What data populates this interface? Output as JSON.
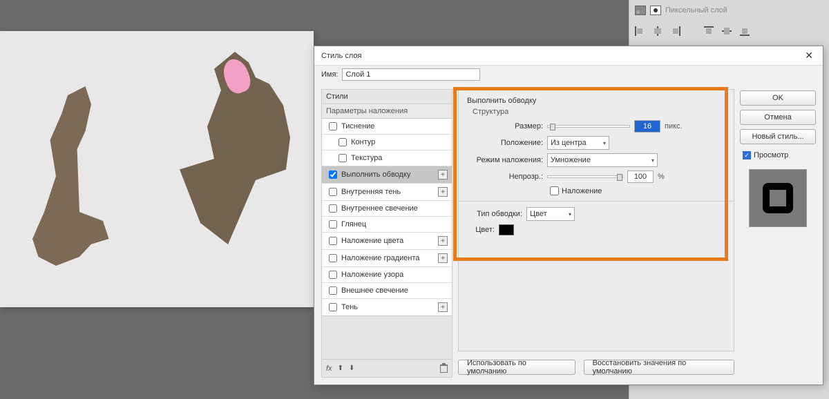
{
  "layerPanel": {
    "layerName": "Пиксельный слой"
  },
  "dialog": {
    "title": "Стиль слоя",
    "nameLabel": "Имя:",
    "nameValue": "Слой 1",
    "stylesHeader": "Стили",
    "paramsHeader": "Параметры наложения",
    "items": [
      {
        "label": "Тиснение",
        "checked": false,
        "indent": false,
        "plus": false
      },
      {
        "label": "Контур",
        "checked": false,
        "indent": true,
        "plus": false
      },
      {
        "label": "Текстура",
        "checked": false,
        "indent": true,
        "plus": false
      },
      {
        "label": "Выполнить обводку",
        "checked": true,
        "indent": false,
        "plus": true,
        "active": true
      },
      {
        "label": "Внутренняя тень",
        "checked": false,
        "indent": false,
        "plus": true
      },
      {
        "label": "Внутреннее свечение",
        "checked": false,
        "indent": false,
        "plus": false
      },
      {
        "label": "Глянец",
        "checked": false,
        "indent": false,
        "plus": false
      },
      {
        "label": "Наложение цвета",
        "checked": false,
        "indent": false,
        "plus": true
      },
      {
        "label": "Наложение градиента",
        "checked": false,
        "indent": false,
        "plus": true
      },
      {
        "label": "Наложение узора",
        "checked": false,
        "indent": false,
        "plus": false
      },
      {
        "label": "Внешнее свечение",
        "checked": false,
        "indent": false,
        "plus": false
      },
      {
        "label": "Тень",
        "checked": false,
        "indent": false,
        "plus": true
      }
    ],
    "fxLabel": "fx",
    "settings": {
      "groupTitle": "Выполнить обводку",
      "structTitle": "Структура",
      "sizeLabel": "Размер:",
      "sizeValue": "16",
      "sizeUnit": "пикс.",
      "positionLabel": "Положение:",
      "positionValue": "Из центра",
      "blendLabel": "Режим наложения:",
      "blendValue": "Умножение",
      "opacityLabel": "Непрозр.:",
      "opacityValue": "100",
      "opacityUnit": "%",
      "overlayLabel": "Наложение",
      "typeLabel": "Тип обводки:",
      "typeValue": "Цвет",
      "colorLabel": "Цвет:",
      "colorValue": "#000000"
    },
    "defaultsUse": "Использовать по умолчанию",
    "defaultsReset": "Восстановить значения по умолчанию",
    "buttons": {
      "ok": "OK",
      "cancel": "Отмена",
      "newStyle": "Новый стиль...",
      "preview": "Просмотр"
    }
  }
}
